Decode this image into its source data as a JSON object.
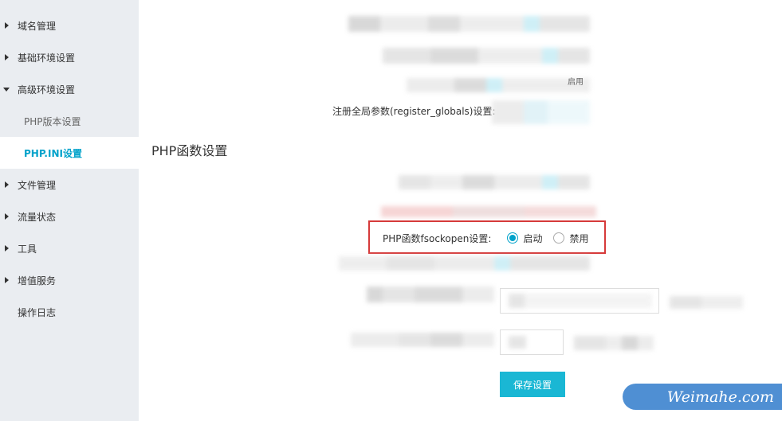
{
  "sidebar": {
    "items": [
      {
        "label": "域名管理"
      },
      {
        "label": "基础环境设置"
      },
      {
        "label": "高级环境设置"
      },
      {
        "label": "PHP版本设置"
      },
      {
        "label": "PHP.INI设置"
      },
      {
        "label": "文件管理"
      },
      {
        "label": "流量状态"
      },
      {
        "label": "工具"
      },
      {
        "label": "增值服务"
      },
      {
        "label": "操作日志"
      }
    ]
  },
  "main": {
    "register_globals_label": "注册全局参数(register_globals)设置:",
    "partial_label": "启用",
    "section_title": "PHP函数设置",
    "fsockopen": {
      "label": "PHP函数fsockopen设置:",
      "option_enable": "启动",
      "option_disable": "禁用",
      "selected": "启动"
    },
    "save_button": "保存设置"
  },
  "colors": {
    "accent": "#00a2ca",
    "button": "#1ab7d4",
    "highlight_border": "#d63a3a",
    "sidebar_bg": "#eaedf1"
  },
  "watermark": {
    "text": "Weimahe.com"
  }
}
